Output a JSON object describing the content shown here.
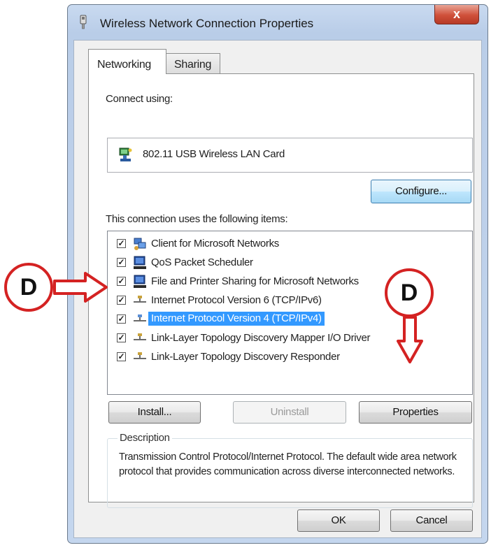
{
  "window": {
    "title": "Wireless Network Connection Properties",
    "close_label": "x"
  },
  "tabs": [
    {
      "label": "Networking",
      "active": true
    },
    {
      "label": "Sharing",
      "active": false
    }
  ],
  "connect_using_label": "Connect using:",
  "adapter_name": "802.11 USB Wireless LAN Card",
  "configure_label": "Configure...",
  "items_label": "This connection uses the following items:",
  "items": [
    {
      "label": "Client for Microsoft Networks",
      "checked": true,
      "icon": "network-client-icon"
    },
    {
      "label": "QoS Packet Scheduler",
      "checked": true,
      "icon": "network-service-icon"
    },
    {
      "label": "File and Printer Sharing for Microsoft Networks",
      "checked": true,
      "icon": "network-service-icon"
    },
    {
      "label": "Internet Protocol Version 6 (TCP/IPv6)",
      "checked": true,
      "icon": "network-protocol-icon"
    },
    {
      "label": "Internet Protocol Version 4 (TCP/IPv4)",
      "checked": true,
      "icon": "network-protocol-icon",
      "selected": true
    },
    {
      "label": "Link-Layer Topology Discovery Mapper I/O Driver",
      "checked": true,
      "icon": "network-protocol-icon"
    },
    {
      "label": "Link-Layer Topology Discovery Responder",
      "checked": true,
      "icon": "network-protocol-icon"
    }
  ],
  "check_mark": "✓",
  "buttons": {
    "install": "Install...",
    "uninstall": "Uninstall",
    "properties": "Properties",
    "ok": "OK",
    "cancel": "Cancel"
  },
  "description": {
    "legend": "Description",
    "text": "Transmission Control Protocol/Internet Protocol. The default wide area network protocol that provides communication across diverse interconnected networks."
  },
  "callouts": [
    {
      "label": "D"
    },
    {
      "label": "D"
    }
  ],
  "colors": {
    "selection": "#3399ff",
    "callout_red": "#d42222",
    "title_gradient_top": "#c9daf0"
  }
}
